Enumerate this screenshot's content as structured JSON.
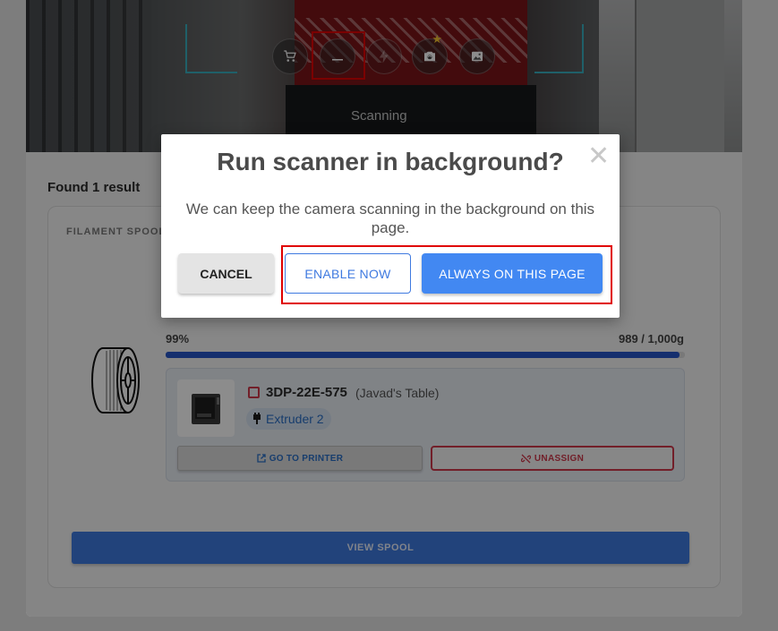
{
  "camera": {
    "scanning_text": "Scanning",
    "buttons": [
      {
        "icon": "cart-icon"
      },
      {
        "icon": "minimize-icon"
      },
      {
        "icon": "flash-icon"
      },
      {
        "icon": "switch-camera-icon"
      },
      {
        "icon": "image-icon"
      }
    ]
  },
  "results": {
    "found_label": "Found 1 result",
    "card": {
      "type_label": "FILAMENT SPOOL",
      "percent_label": "99%",
      "weight_label": "989 / 1,000g",
      "progress": 0.989,
      "printer": {
        "name": "3DP-22E-575",
        "location": "(Javad's Table)",
        "extruder": "Extruder 2",
        "go_button": "GO TO PRINTER",
        "unassign_button": "UNASSIGN"
      },
      "view_button": "VIEW SPOOL"
    }
  },
  "dialog": {
    "title": "Run scanner in background?",
    "close_glyph": "✕",
    "body": "We can keep the camera scanning in the background on this page.",
    "cancel_label": "CANCEL",
    "enable_label": "ENABLE NOW",
    "always_label": "ALWAYS ON THIS PAGE"
  },
  "colors": {
    "primary": "#4288f2",
    "progress": "#2756c8",
    "danger": "#d0394c",
    "highlight": "#e00000"
  }
}
